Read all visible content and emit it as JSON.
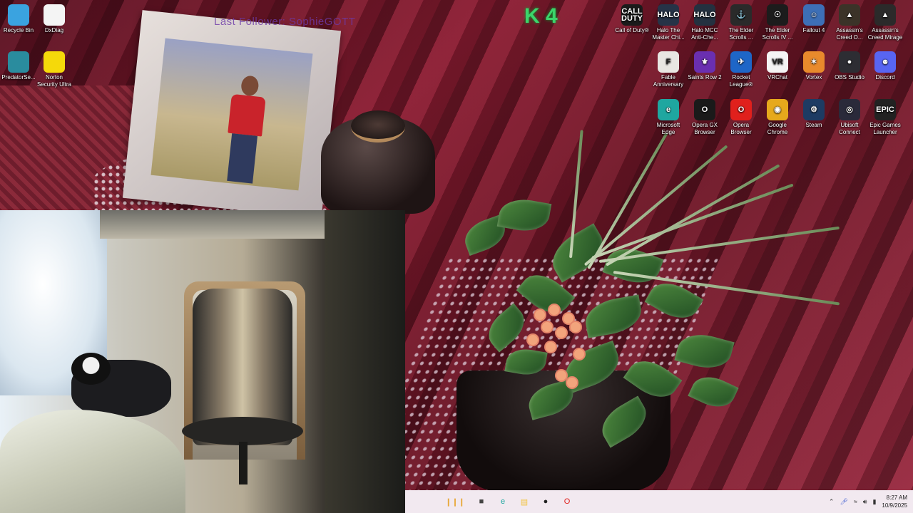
{
  "overlay": {
    "watermark": "Last Follower: SophieGOTT",
    "counter": "K 4"
  },
  "desktop_icons_left": [
    {
      "label": "Recycle Bin",
      "icon": "recycle-bin-icon",
      "color": "#3aa3e0"
    },
    {
      "label": "DxDiag",
      "icon": "document-icon",
      "color": "#f4f4f4"
    },
    {
      "label": "PredatorSe...",
      "icon": "predator-icon",
      "color": "#2a8c9e"
    },
    {
      "label": "Norton Security Ultra",
      "icon": "norton-icon",
      "color": "#f5d90a"
    }
  ],
  "desktop_icons_right": [
    {
      "label": "Call of Duty®",
      "icon": "call-of-duty-icon",
      "color": "#1b1b1b",
      "text": "CALL DUTY"
    },
    {
      "label": "Halo The Master Chi...",
      "icon": "halo-icon",
      "color": "#263347",
      "text": "HALO"
    },
    {
      "label": "Halo MCC Anti-Che...",
      "icon": "halo-mcc-icon",
      "color": "#243140",
      "text": "HALO"
    },
    {
      "label": "The Elder Scrolls ...",
      "icon": "skyrim-icon",
      "color": "#2a2a2a",
      "text": "⚓"
    },
    {
      "label": "The Elder Scrolls IV ...",
      "icon": "oblivion-icon",
      "color": "#1c1c1c",
      "text": "☉"
    },
    {
      "label": "Fallout 4",
      "icon": "fallout-icon",
      "color": "#3d6fb6",
      "text": "☺"
    },
    {
      "label": "Assassin's Creed O...",
      "icon": "assassins-creed-odyssey-icon",
      "color": "#3b3328",
      "text": "▲"
    },
    {
      "label": "Assassin's Creed Mirage",
      "icon": "assassins-creed-mirage-icon",
      "color": "#2b2a2a",
      "text": "▲"
    },
    {
      "label": "Fable Anniversary",
      "icon": "fable-icon",
      "color": "#e8e6e2",
      "text": "F"
    },
    {
      "label": "Saints Row 2",
      "icon": "saints-row-icon",
      "color": "#6a2fb0",
      "text": "⚜"
    },
    {
      "label": "Rocket League®",
      "icon": "rocket-league-icon",
      "color": "#1e66c7",
      "text": "✈"
    },
    {
      "label": "VRChat",
      "icon": "vrchat-icon",
      "color": "#f4f4f4",
      "text": "VR"
    },
    {
      "label": "Vortex",
      "icon": "vortex-icon",
      "color": "#e88a2c",
      "text": "✶"
    },
    {
      "label": "OBS Studio",
      "icon": "obs-icon",
      "color": "#2d2d33",
      "text": "●"
    },
    {
      "label": "Discord",
      "icon": "discord-icon",
      "color": "#5865f2",
      "text": "☻"
    },
    {
      "label": "Microsoft Edge",
      "icon": "edge-icon",
      "color": "#1fa7a0",
      "text": "e"
    },
    {
      "label": "Opera GX Browser",
      "icon": "opera-gx-icon",
      "color": "#1a1a1a",
      "text": "O"
    },
    {
      "label": "Opera Browser",
      "icon": "opera-icon",
      "color": "#e0201c",
      "text": "O"
    },
    {
      "label": "Google Chrome",
      "icon": "chrome-icon",
      "color": "#e6a91c",
      "text": "◉"
    },
    {
      "label": "Steam",
      "icon": "steam-icon",
      "color": "#1d3b63",
      "text": "⚙"
    },
    {
      "label": "Ubisoft Connect",
      "icon": "ubisoft-icon",
      "color": "#2a2a3a",
      "text": "◎"
    },
    {
      "label": "Epic Games Launcher",
      "icon": "epic-games-icon",
      "color": "#222",
      "text": "EPIC"
    }
  ],
  "taskbar": {
    "apps": [
      {
        "icon": "widgets-icon",
        "glyph": "❙❙❙"
      },
      {
        "icon": "task-view-icon",
        "glyph": "■"
      },
      {
        "icon": "edge-icon",
        "glyph": "e"
      },
      {
        "icon": "file-explorer-icon",
        "glyph": "▤"
      },
      {
        "icon": "obs-icon",
        "glyph": "●"
      },
      {
        "icon": "opera-icon",
        "glyph": "O"
      }
    ],
    "time": "8:27 AM",
    "date": "10/9/2025"
  }
}
